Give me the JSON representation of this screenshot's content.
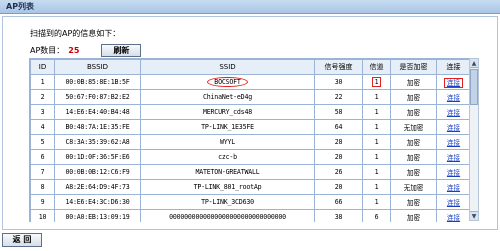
{
  "window": {
    "title": "AP列表"
  },
  "scan": {
    "subtitle": "扫描到的AP的信息如下：",
    "count_label": "AP数目：",
    "count_value": "25",
    "refresh_label": "刷新"
  },
  "table": {
    "headers": {
      "id": "ID",
      "bssid": "BSSID",
      "ssid": "SSID",
      "signal": "信号强度",
      "channel": "信道",
      "encrypted": "是否加密",
      "connect": "连接"
    },
    "rows": [
      {
        "id": "1",
        "bssid": "00:0B:85:8E:1B:5F",
        "ssid": "BOCSOFT",
        "signal": "30",
        "channel": "1",
        "encrypted": "加密",
        "connect": "连接"
      },
      {
        "id": "2",
        "bssid": "50:67:F0:87:B2:E2",
        "ssid": "ChinaNet-eD4g",
        "signal": "22",
        "channel": "1",
        "encrypted": "加密",
        "connect": "连接"
      },
      {
        "id": "3",
        "bssid": "14:E6:E4:40:B4:48",
        "ssid": "MERCURY_cds48",
        "signal": "58",
        "channel": "1",
        "encrypted": "加密",
        "connect": "连接"
      },
      {
        "id": "4",
        "bssid": "B0:48:7A:1E:35:FE",
        "ssid": "TP-LINK_1E35FE",
        "signal": "64",
        "channel": "1",
        "encrypted": "无加密",
        "connect": "连接"
      },
      {
        "id": "5",
        "bssid": "C8:3A:35:39:62:A8",
        "ssid": "WYYL",
        "signal": "28",
        "channel": "1",
        "encrypted": "加密",
        "connect": "连接"
      },
      {
        "id": "6",
        "bssid": "00:1D:0F:36:5F:E6",
        "ssid": "czc-b",
        "signal": "20",
        "channel": "1",
        "encrypted": "加密",
        "connect": "连接"
      },
      {
        "id": "7",
        "bssid": "00:0B:0B:12:C6:F9",
        "ssid": "MATETON-GREATWALL",
        "signal": "26",
        "channel": "1",
        "encrypted": "加密",
        "connect": "连接"
      },
      {
        "id": "8",
        "bssid": "A8:2E:64:D9:4F:73",
        "ssid": "TP-LINK_801_rootAp",
        "signal": "20",
        "channel": "1",
        "encrypted": "无加密",
        "connect": "连接"
      },
      {
        "id": "9",
        "bssid": "14:E6:E4:3C:D6:30",
        "ssid": "TP-LINK_3CD630",
        "signal": "66",
        "channel": "1",
        "encrypted": "加密",
        "connect": "连接"
      },
      {
        "id": "10",
        "bssid": "00:A0:EB:13:09:19",
        "ssid": "0000000000000000000000000000000",
        "signal": "38",
        "channel": "6",
        "encrypted": "加密",
        "connect": "连接"
      }
    ]
  },
  "footer": {
    "back_label": "返 回"
  },
  "colors": {
    "accent_red": "#cc0000",
    "link_blue": "#1a3fbf",
    "header_bg": "#e6eef8"
  }
}
